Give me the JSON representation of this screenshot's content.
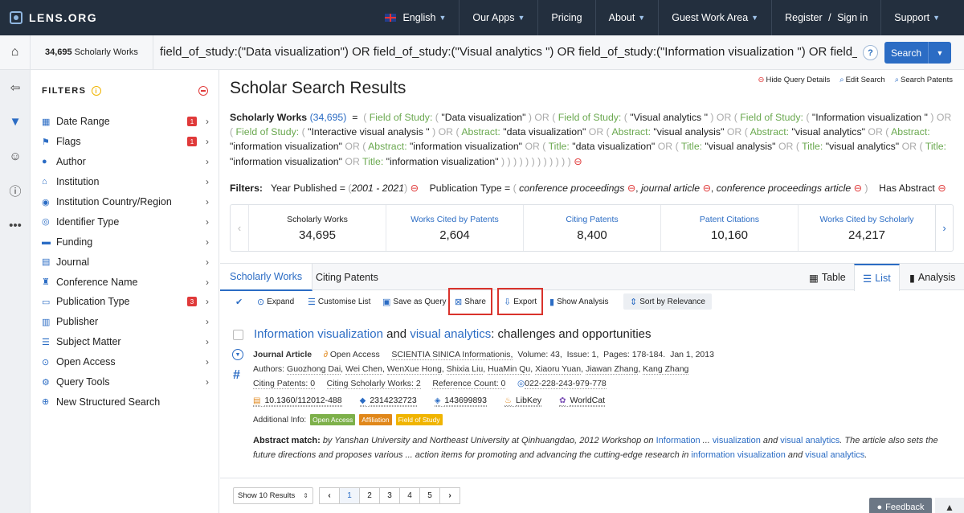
{
  "nav": {
    "logo": "LENS.ORG",
    "language": "English",
    "links": [
      "Our Apps",
      "Pricing",
      "About",
      "Guest Work Area",
      "Register",
      "Sign in",
      "Support"
    ]
  },
  "querybar": {
    "count": "34,695",
    "count_label": "Scholarly Works",
    "query": "field_of_study:(\"Data visualization\") OR field_of_study:(\"Visual analytics \") OR field_of_study:(\"Information visualization \") OR field_of_study:(",
    "help": "?",
    "search_label": "Search"
  },
  "filters": {
    "title": "FILTERS",
    "items": [
      {
        "label": "Date Range",
        "badge": "1"
      },
      {
        "label": "Flags",
        "badge": "1"
      },
      {
        "label": "Author",
        "badge": ""
      },
      {
        "label": "Institution",
        "badge": ""
      },
      {
        "label": "Institution Country/Region",
        "badge": ""
      },
      {
        "label": "Identifier Type",
        "badge": ""
      },
      {
        "label": "Funding",
        "badge": ""
      },
      {
        "label": "Journal",
        "badge": ""
      },
      {
        "label": "Conference Name",
        "badge": ""
      },
      {
        "label": "Publication Type",
        "badge": "3"
      },
      {
        "label": "Publisher",
        "badge": ""
      },
      {
        "label": "Subject Matter",
        "badge": ""
      },
      {
        "label": "Open Access",
        "badge": ""
      },
      {
        "label": "Query Tools",
        "badge": ""
      },
      {
        "label": "New Structured Search",
        "badge": ""
      }
    ]
  },
  "main": {
    "title": "Scholar Search Results",
    "hide_query": "Hide Query Details",
    "edit_search": "Edit Search",
    "search_patents": "Search Patents",
    "query_head": "Scholarly Works",
    "query_count": "(34,695)",
    "filters_label": "Filters:",
    "year_label": "Year Published =",
    "year_value": "2001 - 2021",
    "pubtype_label": "Publication Type =",
    "pubtypes": [
      "conference proceedings",
      "journal article",
      "conference proceedings article"
    ],
    "has_abstract": "Has Abstract"
  },
  "stats": [
    {
      "label": "Scholarly Works",
      "value": "34,695"
    },
    {
      "label": "Works Cited by Patents",
      "value": "2,604"
    },
    {
      "label": "Citing Patents",
      "value": "8,400"
    },
    {
      "label": "Patent Citations",
      "value": "10,160"
    },
    {
      "label": "Works Cited by Scholarly",
      "value": "24,217"
    }
  ],
  "tabs": {
    "scholarly": "Scholarly Works",
    "citing": "Citing Patents",
    "table": "Table",
    "list": "List",
    "analysis": "Analysis"
  },
  "actions": {
    "expand": "Expand",
    "customise": "Customise List",
    "save": "Save as Query",
    "share": "Share",
    "export": "Export",
    "show_analysis": "Show Analysis",
    "sort": "Sort by Relevance"
  },
  "result": {
    "title_parts": [
      "Information",
      "visualization",
      "and",
      "visual",
      "analytics",
      ": challenges and opportunities"
    ],
    "type": "Journal Article",
    "open_access": "Open Access",
    "source": "SCIENTIA SINICA Informationis,",
    "volume": "Volume: 43,",
    "issue": "Issue: 1,",
    "pages": "Pages: 178-184.",
    "date": "Jan 1, 2013",
    "authors_label": "Authors:",
    "authors": [
      "Guozhong Dai",
      "Wei Chen",
      "WenXue Hong",
      "Shixia Liu",
      "HuaMin Qu",
      "Xiaoru Yuan",
      "Jiawan Zhang",
      "Kang Zhang"
    ],
    "citing_patents": "Citing Patents: 0",
    "citing_works": "Citing Scholarly Works: 2",
    "ref_count": "Reference Count: 0",
    "lens_id": "022-228-243-979-778",
    "doi": "10.1360/112012-488",
    "mag": "2314232723",
    "pmid": "143699893",
    "libkey": "LibKey",
    "worldcat": "WorldCat",
    "additional": "Additional Info:",
    "tags": [
      "Open Access",
      "Affiliation",
      "Field of Study"
    ],
    "abstract_label": "Abstract match:"
  },
  "footer": {
    "show": "Show 10 Results",
    "pages": [
      "1",
      "2",
      "3",
      "4",
      "5"
    ],
    "feedback": "Feedback"
  }
}
